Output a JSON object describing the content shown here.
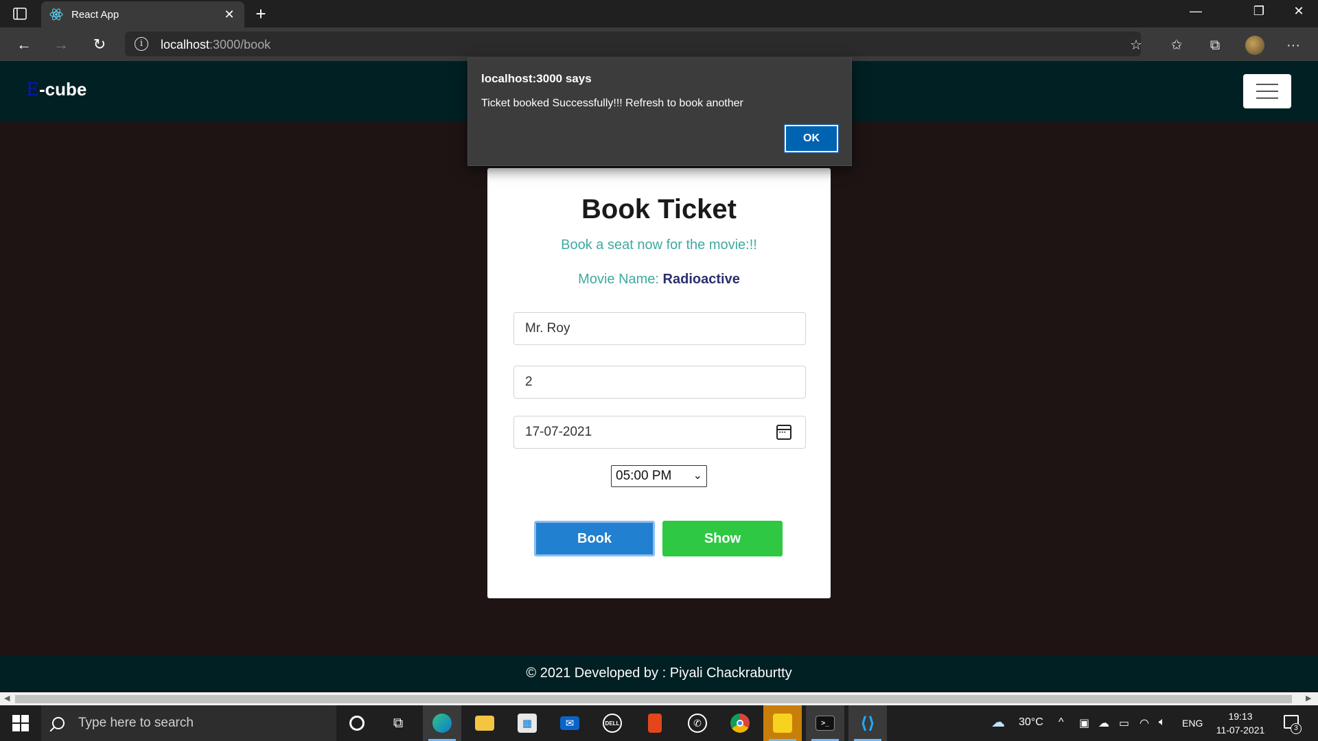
{
  "browser": {
    "tab_title": "React App",
    "tab_close": "✕",
    "new_tab": "+",
    "url_host": "localhost",
    "url_rest": ":3000/book",
    "window_controls": {
      "minimize": "—",
      "restore": "❐",
      "close": "✕"
    },
    "nav": {
      "back": "←",
      "forward": "→",
      "reload": "↻",
      "more": "···"
    }
  },
  "header": {
    "brand_accent": "E",
    "brand_rest": "-cube"
  },
  "dialog": {
    "title": "localhost:3000 says",
    "message": "Ticket booked Successfully!!! Refresh to book another",
    "ok_label": "OK"
  },
  "form": {
    "title": "Book Ticket",
    "subtitle": "Book a seat now for the movie:!!",
    "movie_label": "Movie Name:",
    "movie_name": "Radioactive",
    "name_value": "Mr. Roy",
    "seats_value": "2",
    "date_value": "17-07-2021",
    "time_value": "05:00 PM",
    "book_label": "Book",
    "show_label": "Show"
  },
  "footer": {
    "text": "© 2021 Developed by : Piyali Chackraburtty"
  },
  "taskbar": {
    "search_placeholder": "Type here to search",
    "weather": "30°C",
    "language": "ENG",
    "time": "19:13",
    "date": "11-07-2021",
    "notification_count": "3",
    "apps": [
      "cortana-icon",
      "task-view-icon",
      "edge-icon",
      "file-explorer-icon",
      "store-icon",
      "mail-icon",
      "dell-icon",
      "office-icon",
      "whatsapp-icon",
      "chrome-icon",
      "sticky-notes-icon",
      "terminal-icon",
      "vscode-icon"
    ]
  },
  "colors": {
    "header_bg": "#002024",
    "page_bg": "#1e1414",
    "book_button": "#2180cf",
    "show_button": "#2ec843",
    "subtitle": "#3fa9a0",
    "movie_name": "#2b2f6e"
  }
}
